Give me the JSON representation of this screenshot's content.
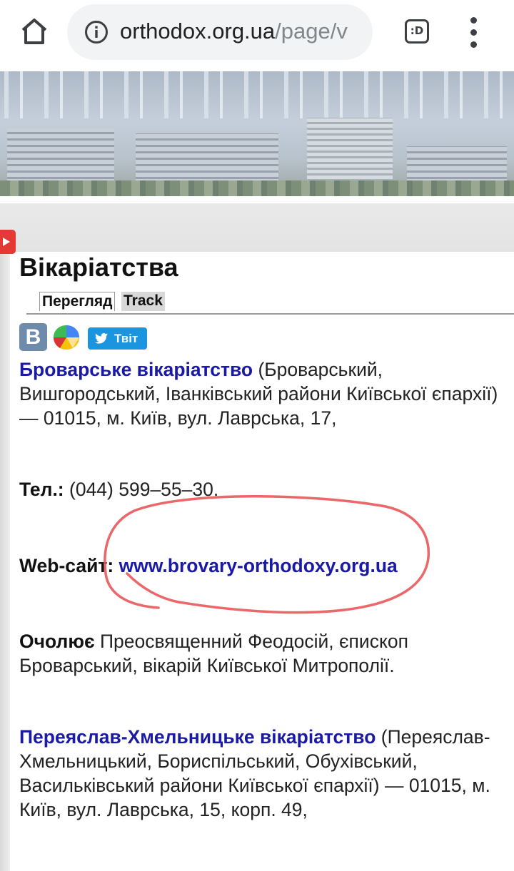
{
  "browser": {
    "url_domain": "orthodox.org.ua",
    "url_path": "/page/v",
    "tabs_glyph": ":D"
  },
  "page": {
    "title": "Вікаріатства",
    "tabs": [
      {
        "label": "Перегляд",
        "active": true
      },
      {
        "label": "Track",
        "active": false
      }
    ],
    "social": {
      "vk_letter": "B",
      "tweet_label": "Твіт"
    },
    "sections": [
      {
        "link_text": "Броварське вікаріатство",
        "description": " (Броварський, Вишгородський, Іванківський райони Київської єпархії) — 01015, м. Київ, вул. Лаврська, 17,",
        "tel_label": "Тел.:",
        "tel_value": " (044) 599–55–30.",
        "web_label": "Web-сайт:",
        "web_value": "www.brovary-orthodoxy.org.ua",
        "head_label": "Очолює",
        "head_value": " Преосвященний Феодосій, єпископ Броварський, вікарій Київської Митрополії."
      },
      {
        "link_text": "Переяслав-Хмельницьке вікаріатство",
        "description": " (Переяслав-Хмельницький, Бориспільський, Обухівський, Васильківський райони Київської єпархії) — 01015, м. Київ, вул. Лаврська, 15, корп. 49,"
      }
    ]
  },
  "colors": {
    "link": "#1a1aa6",
    "annotation_circle": "#e8575a",
    "tweet_button": "#1b95e0",
    "vk_button": "#6f8bab"
  }
}
